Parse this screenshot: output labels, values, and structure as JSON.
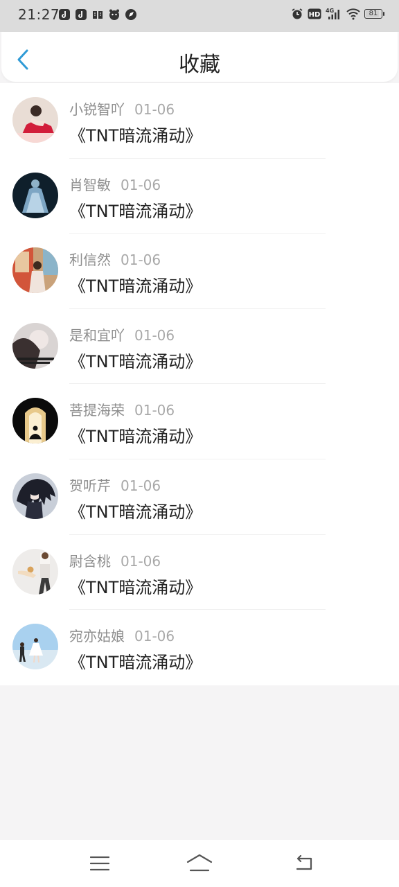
{
  "status": {
    "time": "21:27",
    "battery": "81",
    "network": "4G",
    "hd": "HD"
  },
  "header": {
    "title": "收藏",
    "back_icon": "chevron-left-icon"
  },
  "colors": {
    "accent": "#2f9bd6",
    "status_bar": "#dcdcdc",
    "background": "#f5f4f5"
  },
  "items": [
    {
      "user": "小锐智吖",
      "date": "01-06",
      "title": "《TNT暗流涌动》"
    },
    {
      "user": "肖智敏",
      "date": "01-06",
      "title": "《TNT暗流涌动》"
    },
    {
      "user": "利信然",
      "date": "01-06",
      "title": "《TNT暗流涌动》"
    },
    {
      "user": "是和宜吖",
      "date": "01-06",
      "title": "《TNT暗流涌动》"
    },
    {
      "user": "菩提海荣",
      "date": "01-06",
      "title": "《TNT暗流涌动》"
    },
    {
      "user": "贺听芹",
      "date": "01-06",
      "title": "《TNT暗流涌动》"
    },
    {
      "user": "尉含桃",
      "date": "01-06",
      "title": "《TNT暗流涌动》"
    },
    {
      "user": "宛亦姑娘",
      "date": "01-06",
      "title": "《TNT暗流涌动》"
    }
  ],
  "nav": {
    "menu_icon": "menu-icon",
    "home_icon": "home-icon",
    "back_icon": "back-icon"
  }
}
